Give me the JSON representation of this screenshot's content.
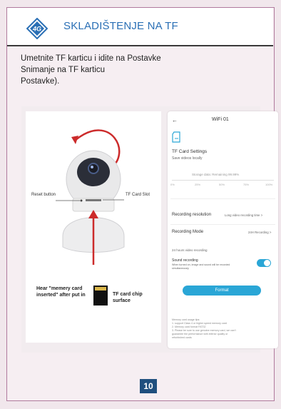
{
  "header": {
    "title": "SKLADIŠTENJE NA TF",
    "logo_text": "4G"
  },
  "intro_lines": [
    "Umetnite TF karticu i idite na Postavke",
    "Snimanje na TF karticu",
    "Postavke)."
  ],
  "camera_illustration": {
    "reset_label": "Reset button",
    "slot_label": "TF Card Slot",
    "hear_label": "Hear \"memery card inserted\" after put in",
    "tf_label": "TF card chip surface"
  },
  "phone": {
    "back": "←",
    "device": "WiFi 01",
    "settings_title": "TF Card Settings",
    "settings_sub": "Save videos locally",
    "storage_label": "Storage data: Remaining 99.99%",
    "scale": [
      "0%",
      "25%",
      "50%",
      "75%",
      "100%"
    ],
    "resolution_label": "Recording resolution",
    "resolution_value": "Long video recording time >",
    "mode_label": "Recording Mode",
    "mode_value": "24H Recording >",
    "hours_note": "24 hours video recording",
    "sound_label": "Sound recording",
    "sound_desc": "When turned on, image and sound will be recorded simultaneously",
    "sound_on": true,
    "format_label": "Format",
    "tips": [
      "Memory card usage tips:",
      "1. support Class 4 or higher speed memory card",
      "2. Memory card format FAT32",
      "3. Please be sure to use genuine memory card, we can't",
      "guarantee the performance with inferior quality or",
      "refurbished cards"
    ]
  },
  "page_number": "10",
  "colors": {
    "accent_blue": "#2a6fb5",
    "border_pink": "#b07a9d",
    "toggle_teal": "#2aa6d6",
    "arrow_red": "#cc2b2b",
    "page_badge": "#1f4f7e"
  }
}
